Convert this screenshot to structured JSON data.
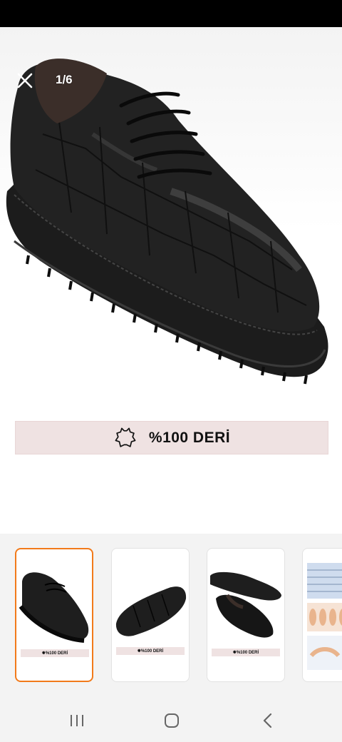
{
  "viewer": {
    "counter": "1/6",
    "close_icon": "close-icon"
  },
  "banner": {
    "text": "%100 DERİ",
    "icon": "leather-hide-icon",
    "bg_color": "#efe2e2"
  },
  "thumbnails": {
    "selected_index": 0,
    "accent_color": "#f27a1a",
    "items": [
      {
        "banner_text": "%100 DERİ"
      },
      {
        "banner_text": "%100 DERİ"
      },
      {
        "banner_text": "%100 DERİ"
      },
      {
        "banner_text": ""
      }
    ]
  },
  "system_nav": {
    "recents_icon": "recents-icon",
    "home_icon": "home-icon",
    "back_icon": "back-icon"
  }
}
